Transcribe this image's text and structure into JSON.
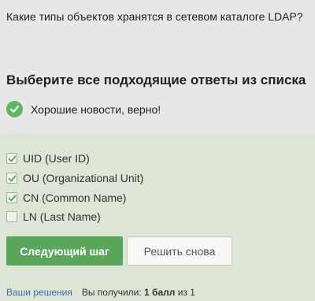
{
  "question": {
    "text": "Какие типы объектов хранятся в сетевом каталоге LDAP?"
  },
  "instruction": "Выберите все подходящие ответы из списка",
  "feedback": {
    "icon": "check-circle-icon",
    "text": "Хорошие новости, верно!",
    "color": "#5cb85c"
  },
  "options": [
    {
      "label": "UID (User ID)",
      "checked": true
    },
    {
      "label": "OU (Organizational Unit)",
      "checked": true
    },
    {
      "label": "CN (Common Name)",
      "checked": true
    },
    {
      "label": "LN (Last Name)",
      "checked": false
    }
  ],
  "buttons": {
    "next_label": "Следующий шаг",
    "retry_label": "Решить снова",
    "accent": "#5aa65a"
  },
  "footer": {
    "solutions_link": "Ваши решения",
    "score_prefix": "Вы получили:",
    "score_value": "1 балл",
    "score_suffix": "из 1"
  }
}
